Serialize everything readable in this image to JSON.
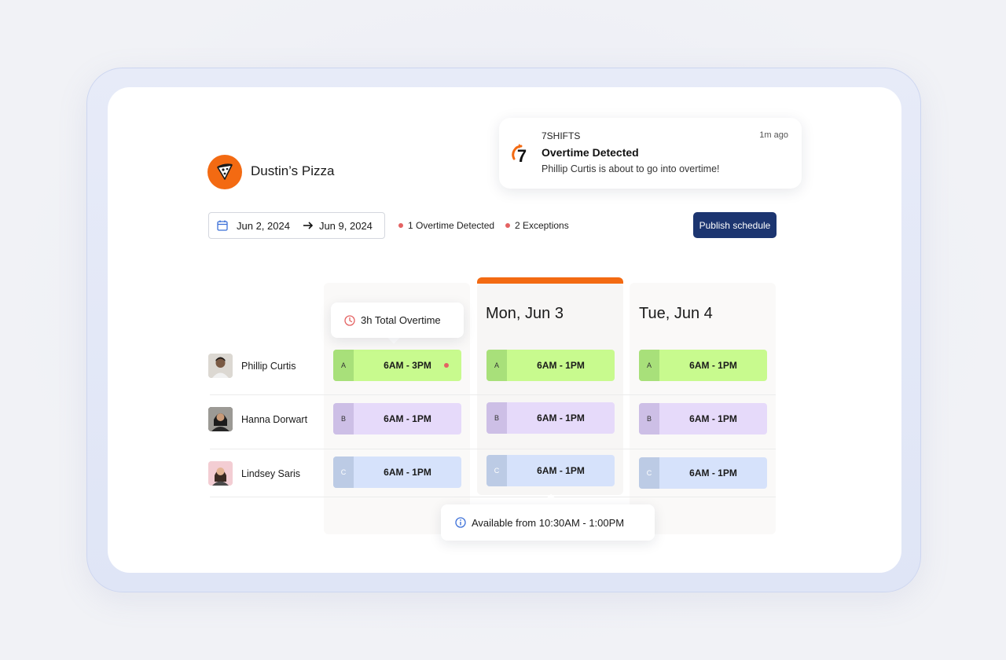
{
  "brand": {
    "name": "Dustin’s Pizza",
    "logo_icon": "pizza-slice-icon",
    "accent": "#f36a12"
  },
  "notification": {
    "app": "7SHIFTS",
    "time": "1m ago",
    "title": "Overtime Detected",
    "message": "Phillip Curtis is about to go into overtime!",
    "logo_text": "7"
  },
  "toolbar": {
    "date_start": "Jun 2, 2024",
    "date_end": "Jun 9, 2024",
    "alerts": [
      "1 Overtime Detected",
      "2 Exceptions"
    ],
    "publish_label": "Publish schedule",
    "publish_color": "#1c3570"
  },
  "schedule": {
    "days": [
      "Mon, Jun 3",
      "Tue, Jun 4"
    ],
    "today": "Mon, Jun 3",
    "employees": [
      {
        "name": "Phillip Curtis",
        "shifts": [
          {
            "position": "A",
            "time": "6AM - 3PM",
            "overtime": true
          },
          {
            "position": "A",
            "time": "6AM - 1PM"
          },
          {
            "position": "A",
            "time": "6AM - 1PM"
          }
        ]
      },
      {
        "name": "Hanna Dorwart",
        "shifts": [
          {
            "position": "B",
            "time": "6AM - 1PM"
          },
          {
            "position": "B",
            "time": "6AM - 1PM"
          },
          {
            "position": "B",
            "time": "6AM - 1PM"
          }
        ]
      },
      {
        "name": "Lindsey Saris",
        "shifts": [
          {
            "position": "C",
            "time": "6AM - 1PM"
          },
          {
            "position": "C",
            "time": "6AM - 1PM"
          },
          {
            "position": "C",
            "time": "6AM - 1PM"
          }
        ]
      }
    ]
  },
  "tooltips": {
    "overtime": "3h Total Overtime",
    "availability": "Available from 10:30AM - 1:00PM"
  }
}
